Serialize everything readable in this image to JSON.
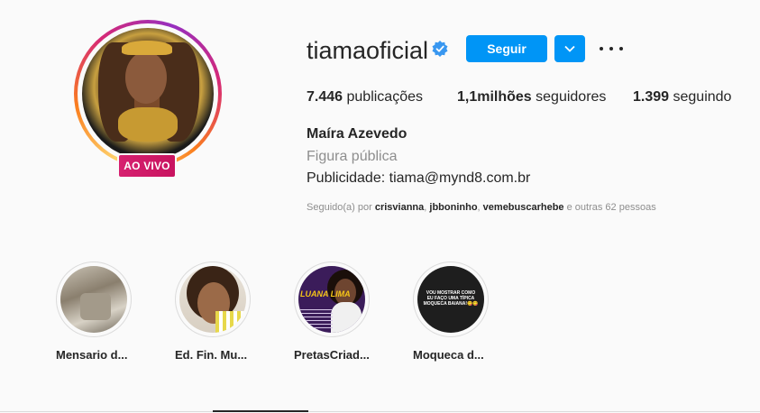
{
  "profile": {
    "username": "tiamaoficial",
    "live_badge": "AO VIVO",
    "follow_label": "Seguir",
    "full_name": "Maíra Azevedo",
    "category": "Figura pública",
    "bio": "Publicidade: tiama@mynd8.com.br",
    "verified_icon": "verified-badge-icon",
    "accent_color": "#0095f6",
    "live_color": "#d6206f"
  },
  "stats": {
    "posts_count": "7.446",
    "posts_label": "publicações",
    "followers_count": "1,1milhões",
    "followers_label": "seguidores",
    "following_count": "1.399",
    "following_label": "seguindo"
  },
  "followed_by": {
    "prefix": "Seguido(a) por",
    "user1": "crisvianna",
    "sep1": ",",
    "user2": "jbboninho",
    "sep2": ",",
    "user3": "vemebuscarhebe",
    "suffix": "e outras 62 pessoas"
  },
  "highlights": [
    {
      "label": "Mensario d..."
    },
    {
      "label": "Ed. Fin. Mu..."
    },
    {
      "label": "PretasCriad...",
      "image_text": "LUANA LIMA"
    },
    {
      "label": "Moqueca d...",
      "image_text": "VOU MOSTRAR COMO EU FAÇO UMA TÍPICA MOQUECA BAIANA!😋😋"
    }
  ]
}
